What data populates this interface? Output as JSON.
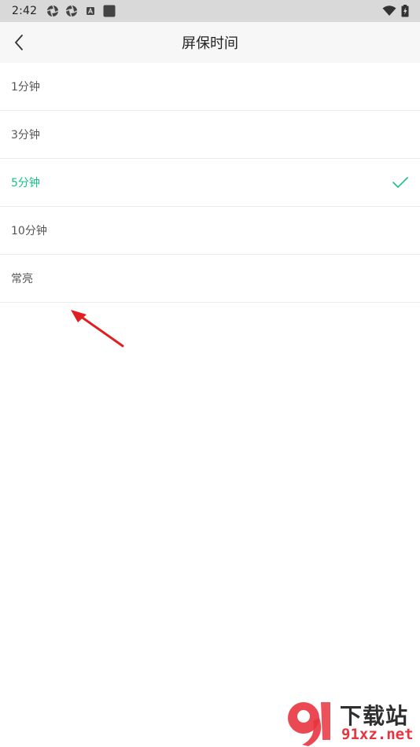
{
  "status_bar": {
    "time": "2:42",
    "left_icons": [
      "aperture-icon",
      "aperture-icon",
      "a-badge-icon",
      "square-app-icon"
    ],
    "right_icons": [
      "wifi-icon",
      "battery-charging-icon"
    ]
  },
  "header": {
    "title": "屏保时间",
    "back_icon": "chevron-left-icon"
  },
  "options": [
    {
      "label": "1分钟",
      "selected": false
    },
    {
      "label": "3分钟",
      "selected": false
    },
    {
      "label": "5分钟",
      "selected": true
    },
    {
      "label": "10分钟",
      "selected": false
    },
    {
      "label": "常亮",
      "selected": false
    }
  ],
  "colors": {
    "accent": "#17c08a",
    "status_bar_bg": "#d9d9d9",
    "header_bg": "#f7f7f7",
    "divider": "#ececec",
    "arrow": "#e02020"
  },
  "watermark": {
    "logo_text": "9",
    "top_text": "下载站",
    "bottom_text": "91xz.net"
  }
}
